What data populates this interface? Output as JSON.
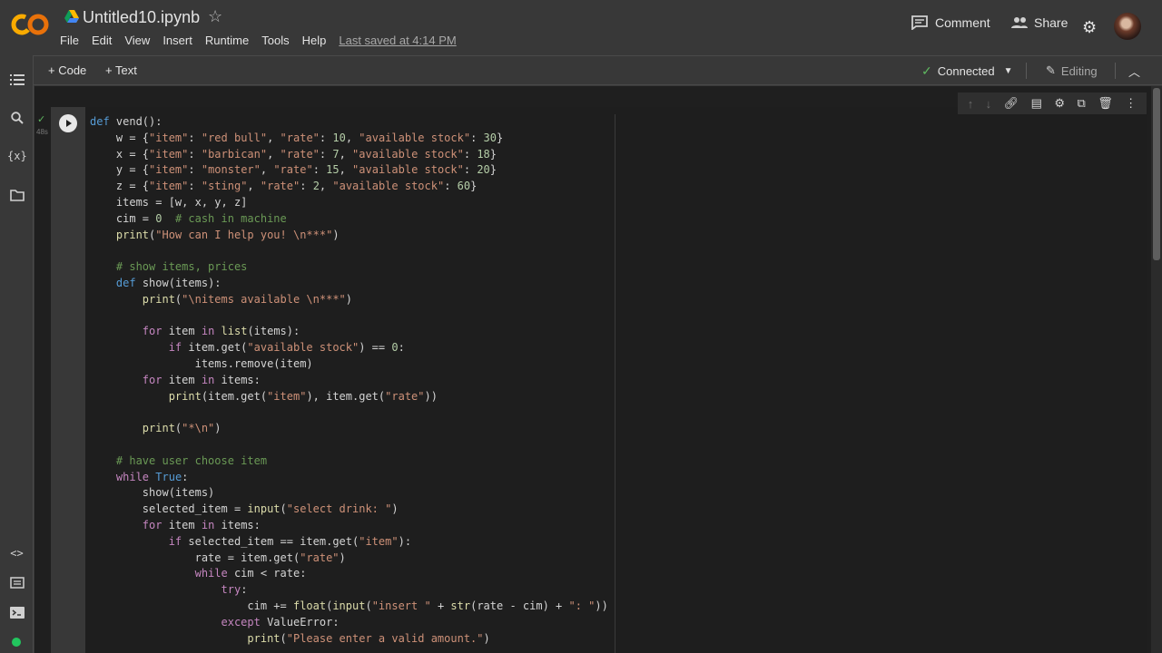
{
  "header": {
    "title": "Untitled10.ipynb",
    "menu": [
      "File",
      "Edit",
      "View",
      "Insert",
      "Runtime",
      "Tools",
      "Help"
    ],
    "last_saved": "Last saved at 4:14 PM",
    "comment_label": "Comment",
    "share_label": "Share"
  },
  "toolbar": {
    "add_code": "+ Code",
    "add_text": "+ Text",
    "connected": "Connected",
    "editing": "Editing"
  },
  "cell": {
    "exec_time": "48s",
    "code_lines": [
      "def vend():",
      "    w = {\"item\": \"red bull\", \"rate\": 10, \"available stock\": 30}",
      "    x = {\"item\": \"barbican\", \"rate\": 7, \"available stock\": 18}",
      "    y = {\"item\": \"monster\", \"rate\": 15, \"available stock\": 20}",
      "    z = {\"item\": \"sting\", \"rate\": 2, \"available stock\": 60}",
      "    items = [w, x, y, z]",
      "    cim = 0  # cash in machine",
      "    print(\"How can I help you! \\n***\")",
      "",
      "    # show items, prices",
      "    def show(items):",
      "        print(\"\\nitems available \\n***\")",
      "",
      "        for item in list(items):",
      "            if item.get(\"available stock\") == 0:",
      "                items.remove(item)",
      "        for item in items:",
      "            print(item.get(\"item\"), item.get(\"rate\"))",
      "",
      "        print(\"*\\n\")",
      "",
      "    # have user choose item",
      "    while True:",
      "        show(items)",
      "        selected_item = input(\"select drink: \")",
      "        for item in items:",
      "            if selected_item == item.get(\"item\"):",
      "                rate = item.get(\"rate\")",
      "                while cim < rate:",
      "                    try:",
      "                        cim += float(input(\"insert \" + str(rate - cim) + \": \"))",
      "                    except ValueError:",
      "                        print(\"Please enter a valid amount.\")"
    ]
  },
  "colors": {
    "keyword": "#c586c0",
    "def": "#569cd6",
    "string": "#ce9178",
    "number": "#b5cea8",
    "comment": "#6a9955",
    "builtin": "#dcdcaa"
  }
}
